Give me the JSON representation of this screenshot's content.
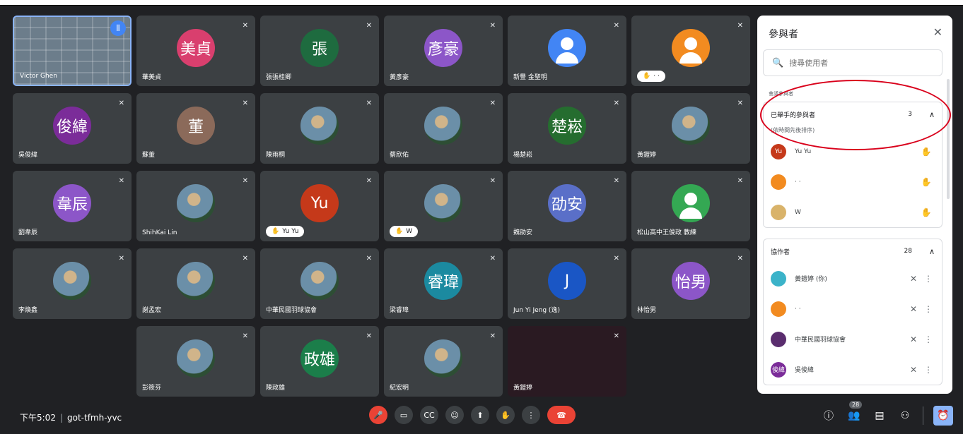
{
  "tiles": [
    {
      "name": "Victor Ghen",
      "avatar": "",
      "kind": "self"
    },
    {
      "name": "華美貞",
      "avatar": "美貞",
      "color": "#d93f6e"
    },
    {
      "name": "張張桂卿",
      "avatar": "張",
      "color": "#1e6b3f"
    },
    {
      "name": "黃彥豪",
      "avatar": "彥豪",
      "color": "#8c56c8"
    },
    {
      "name": "新豐 金聖明",
      "avatar": "",
      "kind": "default"
    },
    {
      "name": "· ·",
      "avatar": "",
      "kind": "default-orange",
      "hand": true
    },
    {
      "name": "吳俊緯",
      "avatar": "俊緯",
      "color": "#7b2c99"
    },
    {
      "name": "蘇董",
      "avatar": "董",
      "color": "#8b6a5a"
    },
    {
      "name": "陳雨桐",
      "avatar": "",
      "kind": "photo"
    },
    {
      "name": "蔡欣佑",
      "avatar": "",
      "kind": "photo"
    },
    {
      "name": "楊楚崧",
      "avatar": "楚崧",
      "color": "#256d2f"
    },
    {
      "name": "黃鎧婷",
      "avatar": "",
      "kind": "photo"
    },
    {
      "name": "劉韋辰",
      "avatar": "韋辰",
      "color": "#8c56c8"
    },
    {
      "name": "ShihKai Lin",
      "avatar": "",
      "kind": "photo"
    },
    {
      "name": "Yu Yu",
      "avatar": "Yu",
      "color": "#c5391a",
      "hand": true
    },
    {
      "name": "W",
      "avatar": "",
      "kind": "photo",
      "hand": true
    },
    {
      "name": "魏劭安",
      "avatar": "劭安",
      "color": "#5a6fc8"
    },
    {
      "name": "松山高中王俊政 教練",
      "avatar": "",
      "kind": "default-green"
    },
    {
      "name": "李煥鑫",
      "avatar": "",
      "kind": "photo"
    },
    {
      "name": "謝孟宏",
      "avatar": "",
      "kind": "photo"
    },
    {
      "name": "中華民國羽球協會",
      "avatar": "",
      "kind": "photo"
    },
    {
      "name": "梁睿瑋",
      "avatar": "睿瑋",
      "color": "#1b8aa0"
    },
    {
      "name": "Jun Yi Jeng (逸)",
      "avatar": "J",
      "color": "#1a56c5"
    },
    {
      "name": "林怡男",
      "avatar": "怡男",
      "color": "#8c56c8"
    },
    {
      "name": "彭筱芬",
      "avatar": "",
      "kind": "photo"
    },
    {
      "name": "陳政雄",
      "avatar": "政雄",
      "color": "#1b7e4a"
    },
    {
      "name": "紀宏明",
      "avatar": "",
      "kind": "photo"
    },
    {
      "name": "黃鎧婷",
      "avatar": "",
      "kind": "dark"
    }
  ],
  "bottom": {
    "time": "下午5:02",
    "separator": "|",
    "meeting_code": "got-tfmh-yvc",
    "participants_badge": "28"
  },
  "panel": {
    "title": "參與者",
    "search_placeholder": "搜尋使用者",
    "section_label": "會議參與者",
    "raised": {
      "title": "已舉手的參與者",
      "count": "3",
      "note": "(依時間先後排序)",
      "people": [
        {
          "name": "Yu Yu",
          "initials": "Yu",
          "color": "#c5391a"
        },
        {
          "name": "· ·",
          "initials": "",
          "color": "#f28b20"
        },
        {
          "name": "W",
          "initials": "",
          "color": "#d9b36a"
        }
      ]
    },
    "collaborators": {
      "title": "協作者",
      "count": "28",
      "people": [
        {
          "name": "黃鎧婷 (你)",
          "initials": "",
          "color": "#3bb3c9"
        },
        {
          "name": "· ·",
          "initials": "",
          "color": "#f28b20"
        },
        {
          "name": "中華民國羽球協會",
          "initials": "",
          "color": "#5a2d6e"
        },
        {
          "name": "吳俊緯",
          "initials": "俊緯",
          "color": "#7b2c99"
        }
      ]
    }
  }
}
